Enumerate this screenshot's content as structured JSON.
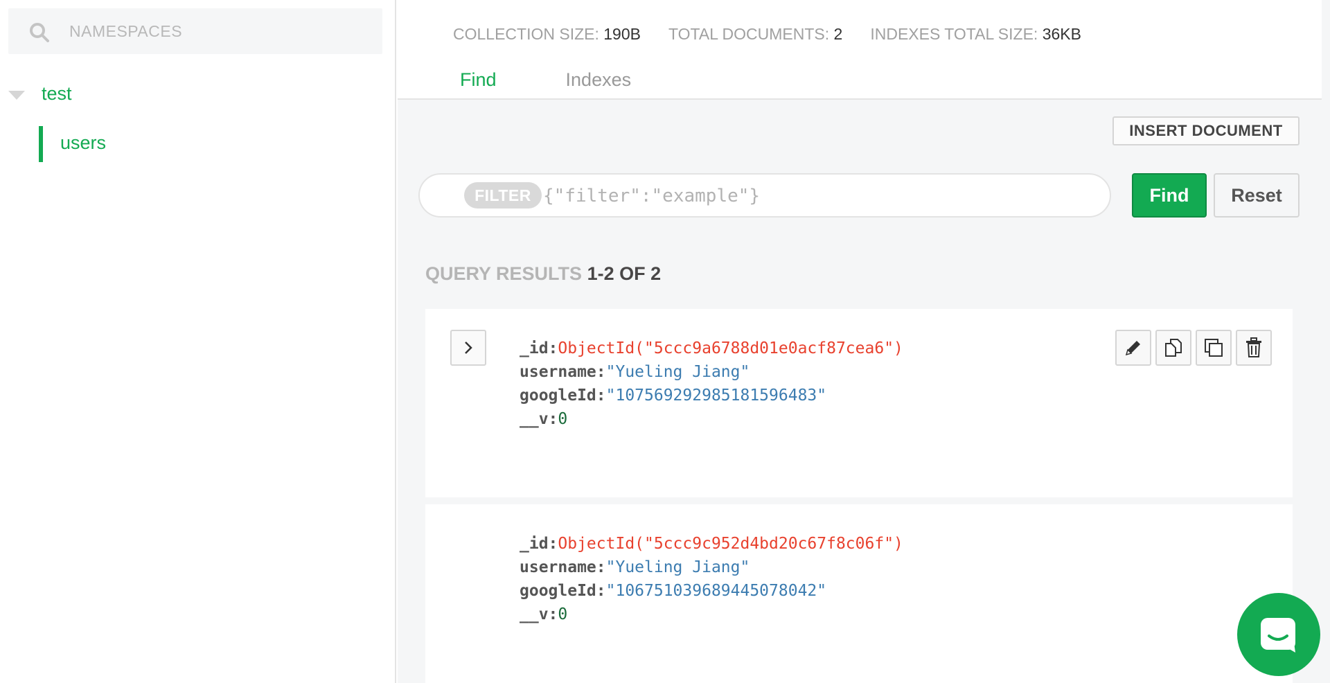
{
  "sidebar": {
    "search_placeholder": "NAMESPACES",
    "database": {
      "label": "test"
    },
    "collection": {
      "label": "users"
    }
  },
  "header": {
    "stats": [
      {
        "label": "COLLECTION SIZE:",
        "value": "190B"
      },
      {
        "label": "TOTAL DOCUMENTS:",
        "value": "2"
      },
      {
        "label": "INDEXES TOTAL SIZE:",
        "value": "36KB"
      }
    ],
    "tabs": [
      {
        "label": "Find",
        "active": true
      },
      {
        "label": "Indexes",
        "active": false
      }
    ]
  },
  "toolbar": {
    "insert_label": "INSERT DOCUMENT",
    "filter_tag": "FILTER",
    "filter_placeholder": "{\"filter\":\"example\"}",
    "find_label": "Find",
    "reset_label": "Reset"
  },
  "results": {
    "label": "QUERY RESULTS",
    "range": "1-2 OF 2"
  },
  "documents": [
    {
      "fields": [
        {
          "key": "_id:",
          "value": "ObjectId(\"5ccc9a6788d01e0acf87cea6\")"
        },
        {
          "key": "username:",
          "value": "\"Yueling Jiang\""
        },
        {
          "key": "googleId:",
          "value": "\"107569292985181596483\""
        },
        {
          "key": "__v:",
          "value": "0"
        }
      ]
    },
    {
      "fields": [
        {
          "key": "_id:",
          "value": "ObjectId(\"5ccc9c952d4bd20c67f8c06f\")"
        },
        {
          "key": "username:",
          "value": "\"Yueling Jiang\""
        },
        {
          "key": "googleId:",
          "value": "\"106751039689445078042\""
        },
        {
          "key": "__v:",
          "value": "0"
        }
      ]
    }
  ],
  "icons": {
    "search": "search-icon",
    "caret": "caret-down-icon",
    "expand": "chevron-right-icon",
    "edit": "pencil-icon",
    "copy": "copy-icon",
    "clone": "clone-icon",
    "delete": "trash-icon",
    "chat": "chat-icon"
  },
  "colors": {
    "accent": "#13aa52",
    "objectid": "#e8412e",
    "string": "#3c7cb0",
    "number": "#1a6b3a"
  }
}
